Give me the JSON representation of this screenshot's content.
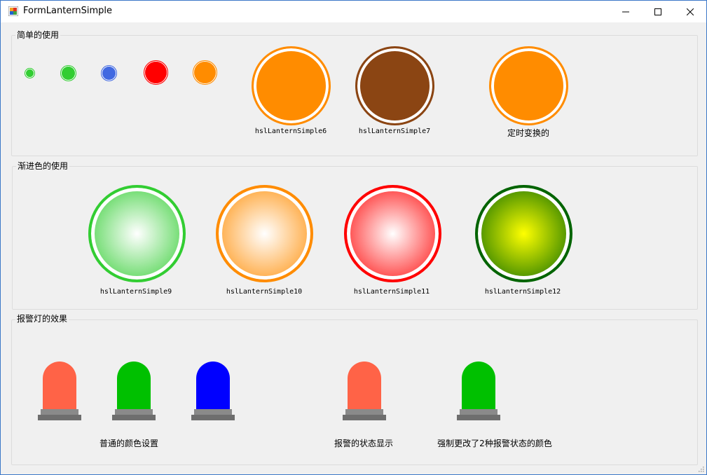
{
  "window": {
    "title": "FormLanternSimple",
    "minimize_icon": "minimize-icon",
    "maximize_icon": "maximize-icon",
    "close_icon": "close-icon"
  },
  "group_simple": {
    "title": "简单的使用",
    "small_lamp_colors": [
      "#32cd32",
      "#32cd32",
      "#4169e1",
      "#ff0000",
      "#ff8c00"
    ],
    "large_lamps": [
      {
        "label": "hslLanternSimple6",
        "color": "#ff8c00"
      },
      {
        "label": "hslLanternSimple7",
        "color": "#8b4513"
      },
      {
        "label": "定时变换的",
        "color": "#ff8c00"
      }
    ]
  },
  "group_gradient": {
    "title": "渐进色的使用",
    "lamps": [
      {
        "label": "hslLanternSimple9",
        "color": "#32cd32",
        "center": "#ffffff"
      },
      {
        "label": "hslLanternSimple10",
        "color": "#ff8c00",
        "center": "#ffffff"
      },
      {
        "label": "hslLanternSimple11",
        "color": "#ff0000",
        "center": "#ffffff"
      },
      {
        "label": "hslLanternSimple12",
        "color": "#006400",
        "center": "#ffff00"
      }
    ]
  },
  "group_alarm": {
    "title": "报警灯的效果",
    "lamp_colors": [
      "#ff6347",
      "#00c000",
      "#0000ff",
      "#ff6347",
      "#00c000"
    ],
    "labels": {
      "normal": "普通的颜色设置",
      "alarm_state": "报警的状态显示",
      "forced": "强制更改了2种报警状态的颜色"
    }
  }
}
